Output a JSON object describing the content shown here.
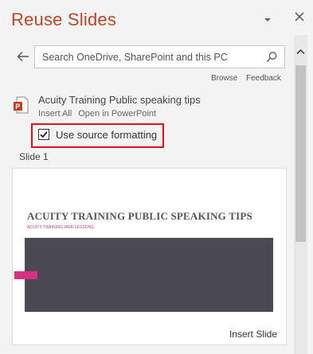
{
  "pane": {
    "title": "Reuse Slides",
    "title_color": "#b7472a"
  },
  "search": {
    "value": "",
    "placeholder": "Search OneDrive, SharePoint and this PC"
  },
  "links": {
    "browse": "Browse",
    "feedback": "Feedback"
  },
  "file": {
    "name": "Acuity Training Public speaking tips",
    "actions": [
      "Insert All",
      "Open in PowerPoint"
    ],
    "icon": "powerpoint-file-icon"
  },
  "options": {
    "use_source_formatting_label": "Use source formatting",
    "use_source_formatting_checked": true,
    "highlight_color": "#e0101a"
  },
  "slides": [
    {
      "label": "Slide 1",
      "thumbnail": {
        "title": "ACUITY TRAINING PUBLIC SPEAKING TIPS",
        "subtitle": "ACUITY TRAINING WEB LESSONS"
      },
      "insert_label": "Insert Slide"
    }
  ],
  "colors": {
    "background": "#f3f3f3",
    "slide_dark": "#4a4954",
    "slide_accent": "#d5327f"
  }
}
